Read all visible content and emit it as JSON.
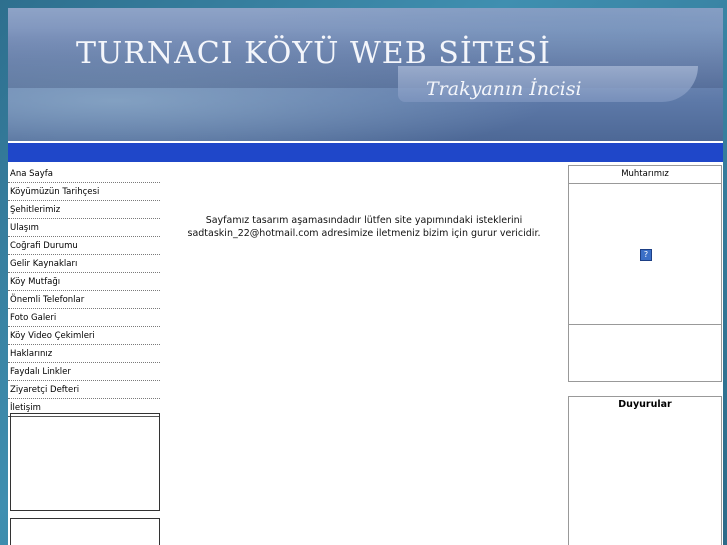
{
  "header": {
    "title": "TURNACI KÖYÜ WEB SİTESİ",
    "subtitle": "Trakyanın İncisi"
  },
  "nav": {
    "items": [
      "Ana Sayfa",
      "Köyümüzün Tarihçesi",
      "Şehitlerimiz",
      "Ulaşım",
      "Coğrafi Durumu",
      "Gelir Kaynakları",
      "Köy Mutfağı",
      "Önemli Telefonlar",
      "Foto Galeri",
      "Köy Video Çekimleri",
      "Haklarınız",
      "Faydalı Linkler",
      "Ziyaretçi Defteri",
      "İletişim"
    ]
  },
  "main": {
    "message_line1": "Sayfamız tasarım aşamasındadır lütfen site yapımındaki isteklerini",
    "message_line2": "sadtaskin_22@hotmail.com adresimize iletmeniz bizim için gurur vericidir."
  },
  "right": {
    "muhtar_title": "Muhtarımız",
    "duyuru_title": "Duyurular"
  },
  "colors": {
    "bar": "#1f47c9",
    "background": "#3f8fb0"
  }
}
